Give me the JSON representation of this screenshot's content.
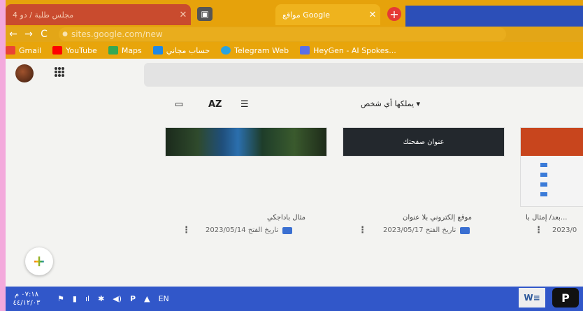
{
  "tabs": {
    "inactive_title": "مجلس طلبة / دو 4",
    "inactive_close": "✕",
    "active_title": "مواقع Google",
    "active_close": "✕",
    "new_tab": "+"
  },
  "nav": {
    "back": "←",
    "forward": "→",
    "reload": "C",
    "url": "sites.google.com/new"
  },
  "bookmarks": [
    {
      "label": "Gmail",
      "color": "#ea4335"
    },
    {
      "label": "YouTube",
      "color": "#ff0000"
    },
    {
      "label": "Maps",
      "color": "#34a853"
    },
    {
      "label": "حساب مجاني",
      "color": "#1e88e5"
    },
    {
      "label": "Telegram Web",
      "color": "#2aa3df"
    },
    {
      "label": "HeyGen - AI Spokes...",
      "color": "#5b6fe6"
    }
  ],
  "toolbar": {
    "folder_icon": "▭",
    "sort_icon": "AZ",
    "list_icon": "☰",
    "owner_filter": "يملكها أي شخص ▾"
  },
  "cards": [
    {
      "title": "مثال باداجكي",
      "date": "2023/05/14 تاريخ الفتح"
    },
    {
      "title": "موقع إلكتروني بلا عنوان",
      "date": "2023/05/17 تاريخ الفتح",
      "thumb_text": "عنوان صفحتك"
    },
    {
      "title": "بعد/ إمثال با...",
      "date": "2023/0"
    }
  ],
  "kebab": "⋮",
  "fab": "+",
  "taskbar": {
    "time": "٠٧:١٨ م",
    "date": "٤٤/١٢/٠٣",
    "lang": "EN",
    "word": "W",
    "p": "P"
  }
}
